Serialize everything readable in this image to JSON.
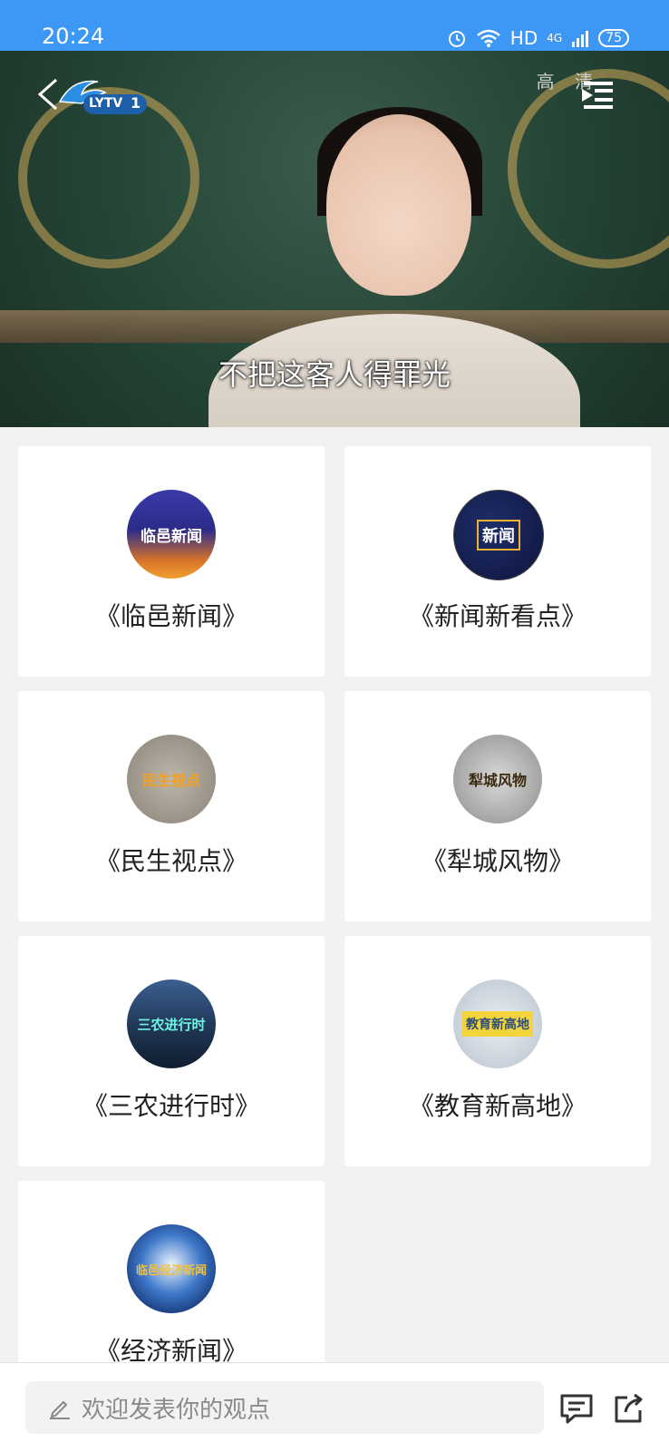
{
  "status_bar": {
    "time": "20:24",
    "network": "HD",
    "signal": "4G",
    "battery": "75"
  },
  "video": {
    "channel_logo": "LYTV",
    "channel_number": "1",
    "quality": "高 清",
    "subtitle": "不把这客人得罪光"
  },
  "programs": [
    {
      "title": "《临邑新闻》",
      "thumb_text": "临邑新闻"
    },
    {
      "title": "《新闻新看点》",
      "thumb_text": "新闻"
    },
    {
      "title": "《民生视点》",
      "thumb_text": "民生视点"
    },
    {
      "title": "《犁城风物》",
      "thumb_text": "犁城风物"
    },
    {
      "title": "《三农进行时》",
      "thumb_text": "三农进行时"
    },
    {
      "title": "《教育新高地》",
      "thumb_text": "教育新高地"
    },
    {
      "title": "《经济新闻》",
      "thumb_text": "临邑经济新闻"
    }
  ],
  "comment_bar": {
    "placeholder": "欢迎发表你的观点"
  },
  "colors": {
    "status_bar": "#3d97f5",
    "background": "#f2f2f2"
  }
}
